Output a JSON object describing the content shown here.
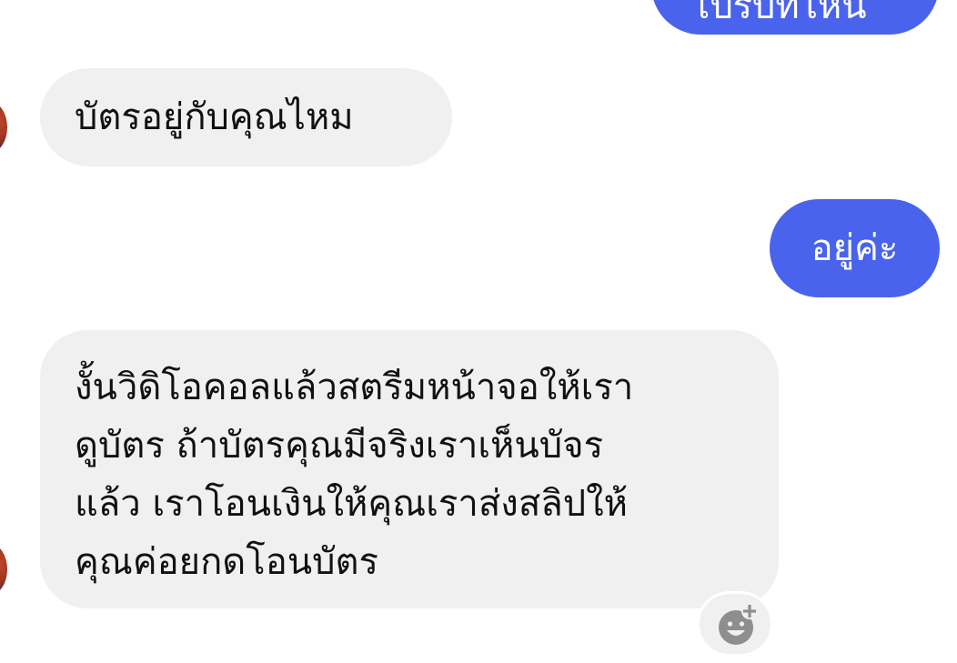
{
  "messages": {
    "top_outgoing": "ไปรับที่ไหน",
    "card_question": "บัตรอยู่กับคุณไหม",
    "yes_reply": "อยู่ค่ะ",
    "long_message_lines": [
      "งั้นวิดิโอคอลแล้วสตรีมหน้าจอให้เรา",
      "ดูบัตร ถ้าบัตรคุณมีจริงเราเห็นบัจร",
      "แล้ว เราโอนเงินให้คุณเราส่งสลิปให้",
      "คุณค่อยกดโอนบัตร"
    ]
  },
  "icons": {
    "react": "add-reaction-icon"
  },
  "colors": {
    "outgoing_bubble": "#4a63ec",
    "incoming_bubble": "#f0f0f0",
    "text": "#111111"
  }
}
